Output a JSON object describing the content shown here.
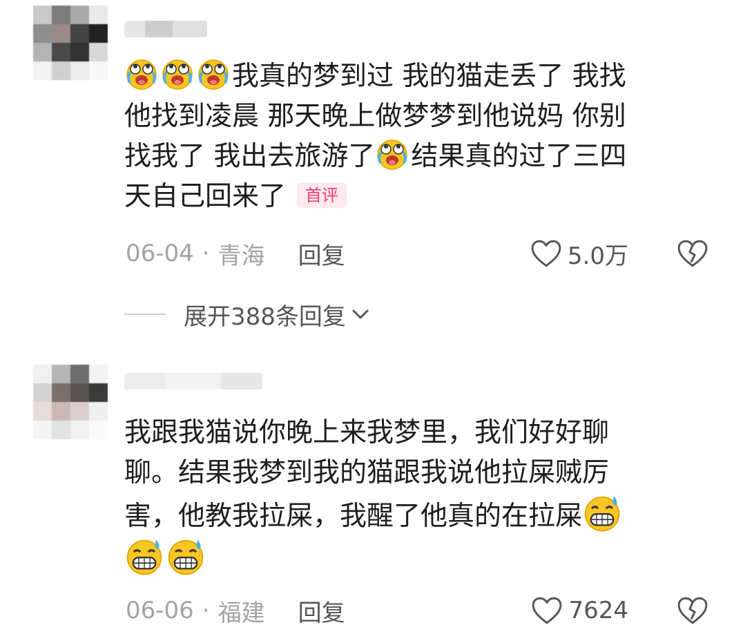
{
  "comments": [
    {
      "text_lines": [
        {
          "emojis_before": [
            "crying-laughing-emoji",
            "crying-laughing-emoji",
            "crying-laughing-emoji"
          ],
          "text": "我真的梦到过 我的猫走丢了 我找"
        },
        {
          "text": "他找到凌晨  那天晚上做梦梦到他说妈 你别"
        },
        {
          "text_before": "找我了 我出去旅游了",
          "emoji": "crying-laughing-emoji",
          "text_after": "结果真的过了三四"
        },
        {
          "text": "天自己回来了"
        }
      ],
      "tag": "首评",
      "date": "06-04",
      "separator": "·",
      "location": "青海",
      "reply_label": "回复",
      "like_count": "5.0万"
    },
    {
      "text_lines": [
        {
          "text": "我跟我猫说你晚上来我梦里，我们好好聊"
        },
        {
          "text": "聊。结果我梦到我的猫跟我说他拉屎贼厉"
        },
        {
          "text": "害，他教我拉屎，我醒了他真的在拉屎"
        },
        {
          "emojis": [
            "grinning-sweat-emoji",
            "grinning-sweat-emoji"
          ]
        }
      ],
      "date": "06-06",
      "separator": "·",
      "location": "福建",
      "reply_label": "回复",
      "like_count": "7624"
    }
  ],
  "expand_replies_label": "展开388条回复",
  "colors": {
    "tag_bg": "#fde9ee",
    "tag_text": "#ef3f6a",
    "meta_text": "#a3a3a3",
    "text": "#1e1e1e"
  }
}
